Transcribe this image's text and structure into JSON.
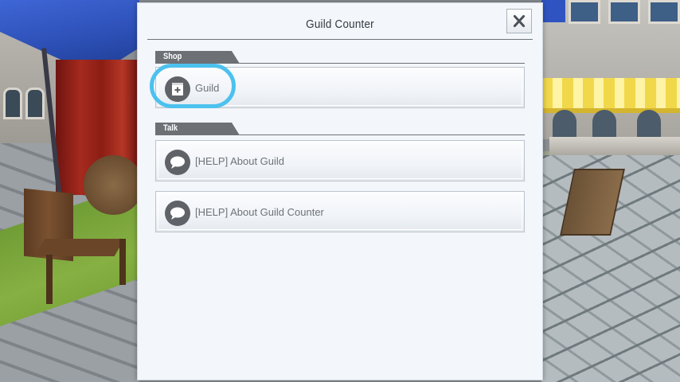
{
  "dialog": {
    "title": "Guild Counter",
    "close_icon": "close-icon"
  },
  "sections": [
    {
      "label": "Shop",
      "items": [
        {
          "label": "Guild",
          "icon": "guild-shop-icon",
          "highlighted": true
        }
      ]
    },
    {
      "label": "Talk",
      "items": [
        {
          "label": "[HELP] About Guild",
          "icon": "speech-bubble-icon"
        },
        {
          "label": "[HELP] About Guild Counter",
          "icon": "speech-bubble-icon"
        }
      ]
    }
  ],
  "colors": {
    "dialog_bg": "#f3f6fa",
    "section_tab": "#6d7176",
    "highlight_ring": "#4cc1ee",
    "icon_bg": "#5f6368"
  }
}
